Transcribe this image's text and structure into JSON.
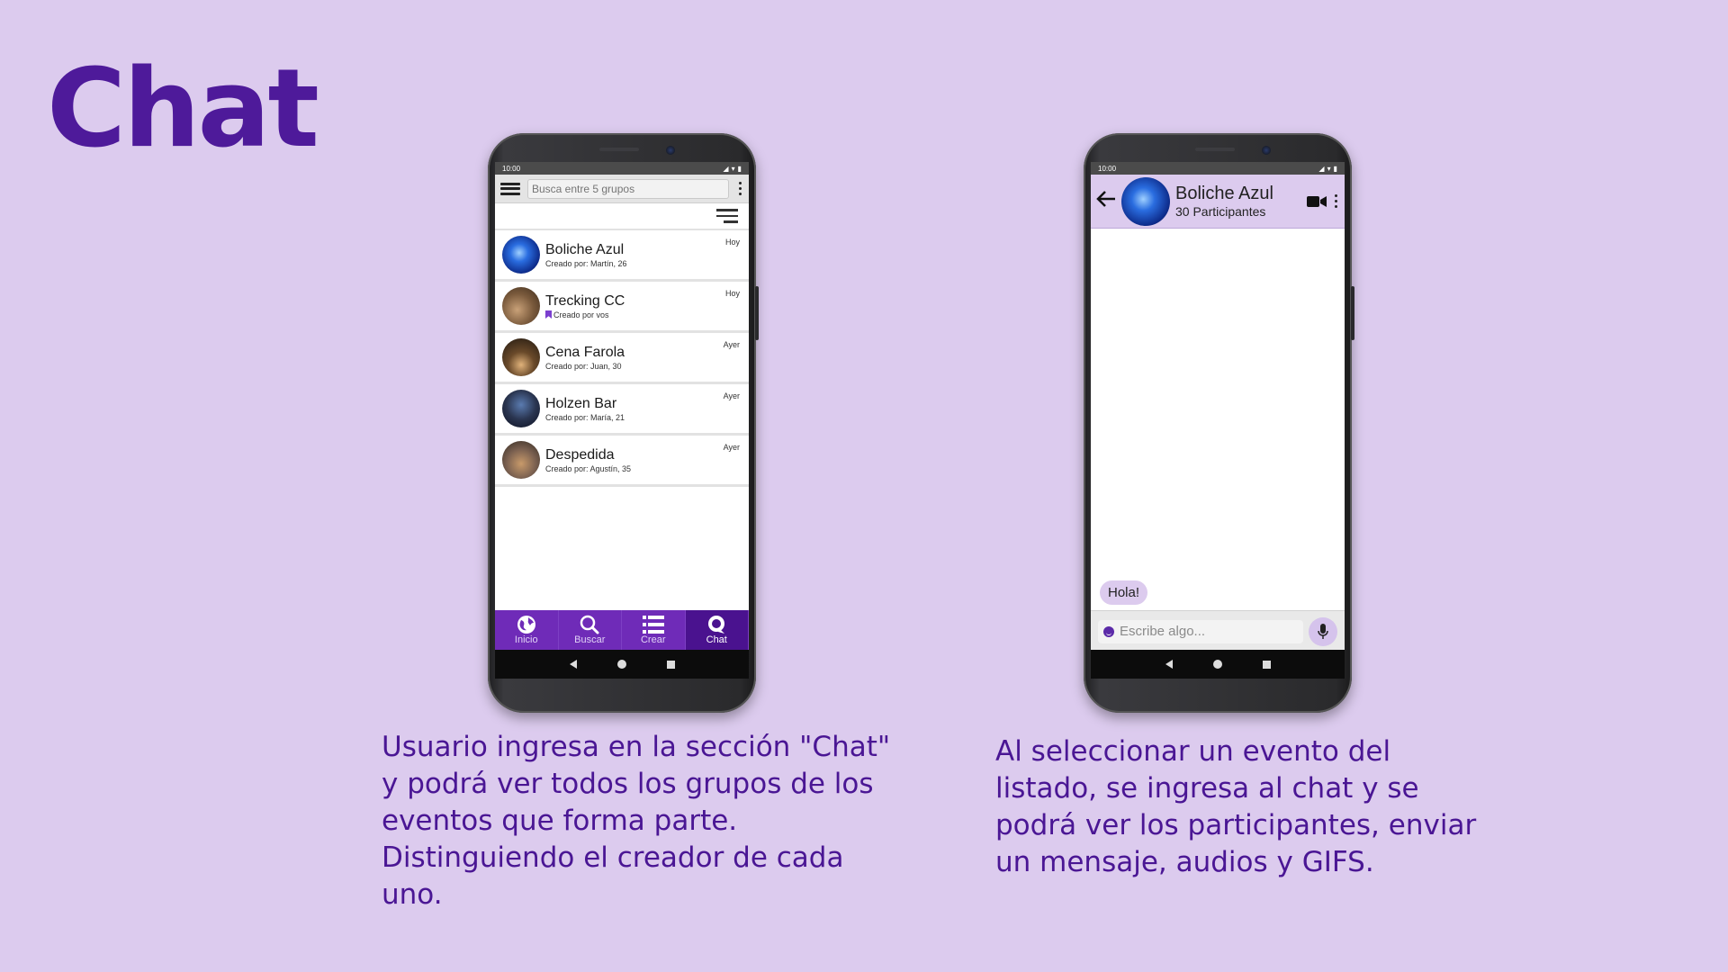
{
  "slide": {
    "title": "Chat",
    "caption_left": "Usuario ingresa en la sección \"Chat\" y podrá ver todos los grupos de los eventos que forma parte. Distinguiendo el creador de cada uno.",
    "caption_right": "Al seleccionar un evento del listado, se ingresa al chat y se podrá ver los participantes, enviar un mensaje, audios y GIFS."
  },
  "phone_left": {
    "status_time": "10:00",
    "search_placeholder": "Busca entre 5 grupos",
    "chats": [
      {
        "name": "Boliche Azul",
        "subtitle": "Creado por: Martín, 26",
        "time": "Hoy"
      },
      {
        "name": "Trecking CC",
        "subtitle": "Creado por vos",
        "time": "Hoy"
      },
      {
        "name": "Cena Farola",
        "subtitle": "Creado por: Juan, 30",
        "time": "Ayer"
      },
      {
        "name": "Holzen Bar",
        "subtitle": "Creado por: María, 21",
        "time": "Ayer"
      },
      {
        "name": "Despedida",
        "subtitle": "Creado por: Agustín, 35",
        "time": "Ayer"
      }
    ],
    "nav": [
      {
        "label": "Inicio",
        "icon": "globe-icon"
      },
      {
        "label": "Buscar",
        "icon": "search-icon"
      },
      {
        "label": "Crear",
        "icon": "list-icon"
      },
      {
        "label": "Chat",
        "icon": "chat-bubble-icon",
        "active": true
      }
    ]
  },
  "phone_right": {
    "status_time": "10:00",
    "chat_name": "Boliche Azul",
    "participants": "30 Participantes",
    "message": "Hola!",
    "input_placeholder": "Escribe algo..."
  },
  "colors": {
    "background": "#dccbee",
    "accent": "#4e1a9a",
    "nav_bar": "#6f2bb8",
    "nav_active": "#4a128f"
  }
}
